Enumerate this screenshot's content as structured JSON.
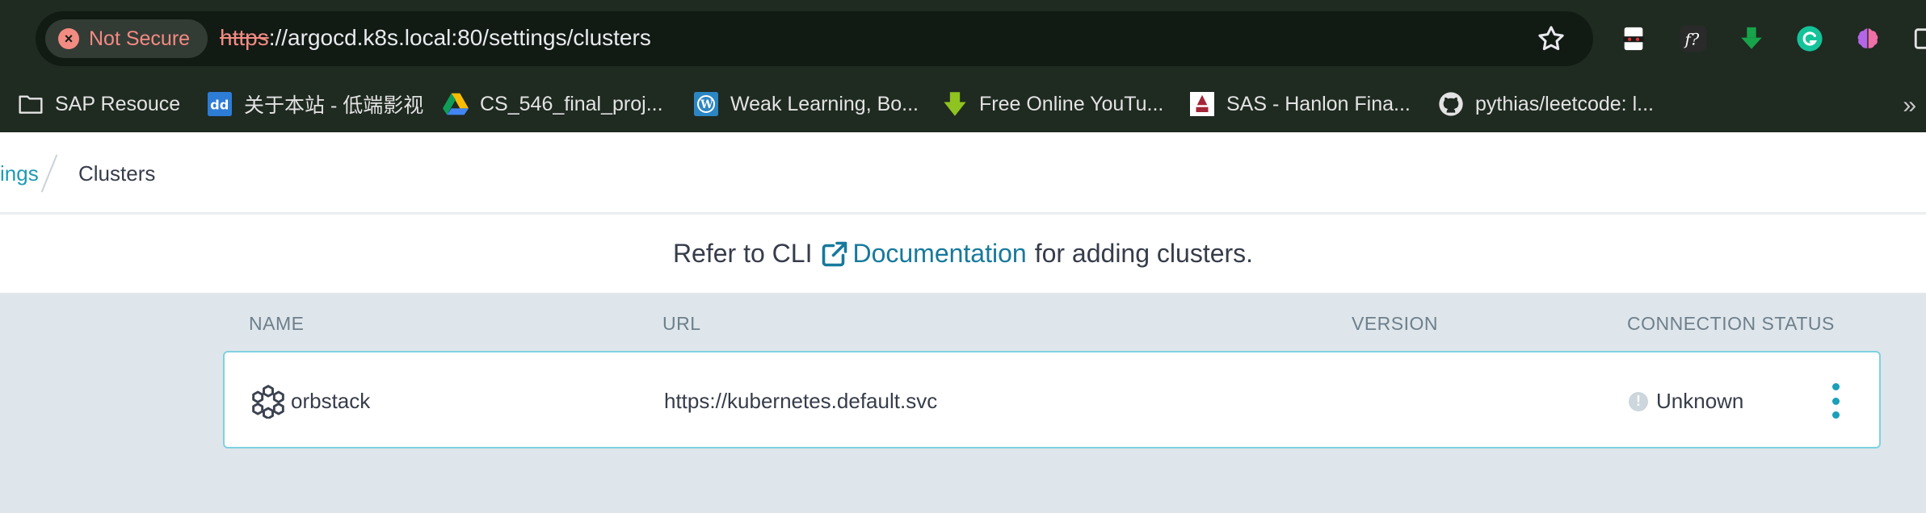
{
  "browser": {
    "security_label": "Not Secure",
    "url_scheme": "https",
    "url_rest": "://argocd.k8s.local:80/settings/clusters",
    "bookmarks": [
      {
        "label": "SAP Resouce",
        "icon": "folder-icon"
      },
      {
        "label": "关于本站 - 低端影视",
        "icon": "dd-site-icon"
      },
      {
        "label": "CS_546_final_proj...",
        "icon": "google-drive-icon"
      },
      {
        "label": "Weak Learning, Bo...",
        "icon": "wordpress-icon"
      },
      {
        "label": "Free Online YouTu...",
        "icon": "download-arrow-icon"
      },
      {
        "label": "SAS - Hanlon Fina...",
        "icon": "stevens-icon"
      },
      {
        "label": "pythias/leetcode: l...",
        "icon": "github-icon"
      }
    ],
    "bookmarks_more": "»"
  },
  "breadcrumb": {
    "parent": "ings",
    "current": "Clusters"
  },
  "info": {
    "prefix": "Refer to CLI",
    "link": "Documentation",
    "suffix": "for adding clusters."
  },
  "table": {
    "columns": [
      "NAME",
      "URL",
      "VERSION",
      "CONNECTION STATUS"
    ],
    "rows": [
      {
        "name": "orbstack",
        "url": "https://kubernetes.default.svc",
        "version": "",
        "status": "Unknown"
      }
    ]
  },
  "colors": {
    "accent": "#1aa0b8",
    "link": "#17799c",
    "chrome_bg": "#1f2a21",
    "page_bg": "#dee6eb"
  }
}
